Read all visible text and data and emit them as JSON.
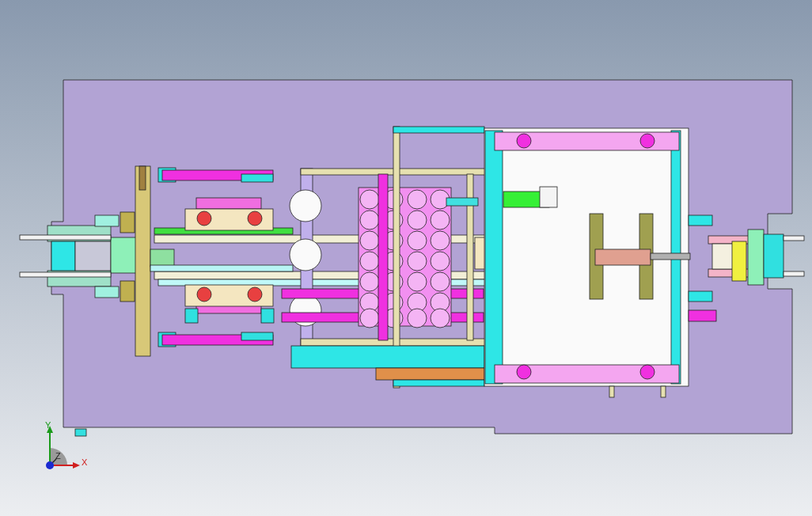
{
  "viewport": {
    "axes": [
      {
        "label": "Y"
      },
      {
        "label": "Z"
      },
      {
        "label": "X"
      }
    ]
  }
}
